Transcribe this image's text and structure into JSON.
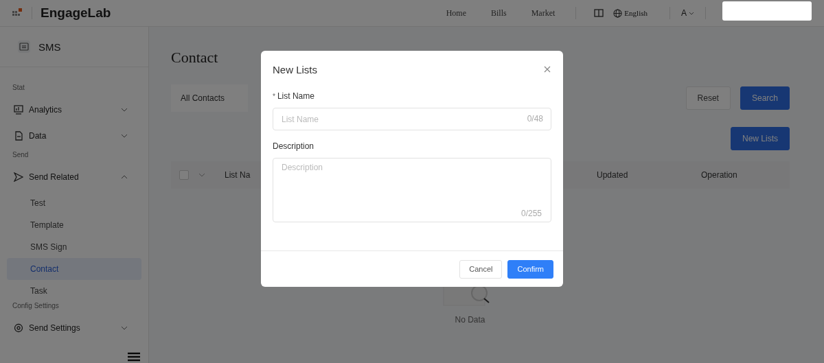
{
  "header": {
    "brand": "EngageLab",
    "nav": [
      "Home",
      "Bills",
      "Market"
    ],
    "language": "English",
    "font_size": "A"
  },
  "sidebar": {
    "product": "SMS",
    "items": [
      {
        "kind": "section",
        "label": "Stat"
      },
      {
        "kind": "group",
        "label": "Analytics",
        "expanded": false
      },
      {
        "kind": "group",
        "label": "Data",
        "expanded": false
      },
      {
        "kind": "section",
        "label": "Send"
      },
      {
        "kind": "group",
        "label": "Send Related",
        "expanded": true
      },
      {
        "kind": "sub",
        "label": "Test",
        "selected": false
      },
      {
        "kind": "sub",
        "label": "Template",
        "selected": false
      },
      {
        "kind": "sub",
        "label": "SMS Sign",
        "selected": false
      },
      {
        "kind": "sub",
        "label": "Contact",
        "selected": true
      },
      {
        "kind": "sub",
        "label": "Task",
        "selected": false
      },
      {
        "kind": "section",
        "label": "Config Settings"
      },
      {
        "kind": "group",
        "label": "Send Settings",
        "expanded": false
      }
    ]
  },
  "page": {
    "title": "Contact",
    "filter": {
      "value": "All Contacts"
    },
    "buttons": [
      "Reset",
      "Search"
    ],
    "new_button": "New Lists",
    "table": {
      "select_all_checked": false,
      "columns": [
        "List Na",
        "Updated",
        "Operation"
      ]
    },
    "empty": "No Data"
  },
  "dialog": {
    "title": "New Lists",
    "fields": [
      {
        "kind": "input",
        "label": "List Name",
        "required_mark": "*",
        "placeholder": "List Name",
        "counter": "0/48"
      },
      {
        "kind": "textarea",
        "label": "Description",
        "placeholder": "Description",
        "counter": "0/255"
      }
    ],
    "buttons": [
      "Cancel",
      "Confirm"
    ]
  }
}
